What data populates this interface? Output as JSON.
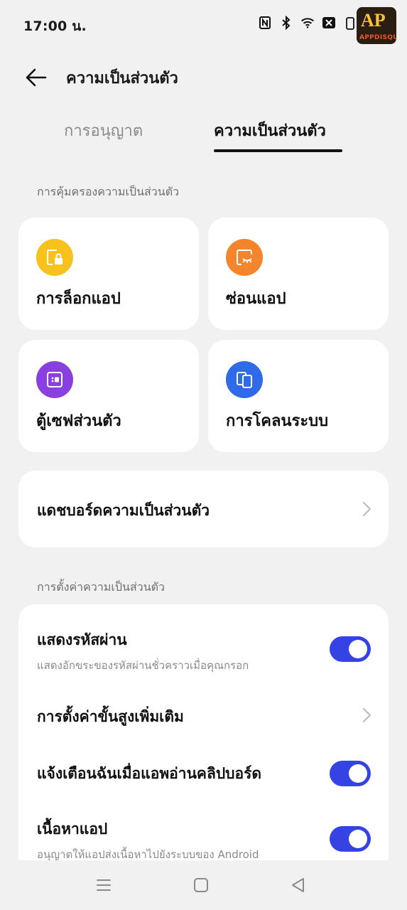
{
  "status_bar": {
    "time": "17:00 น.",
    "icons": [
      "nfc-icon",
      "bluetooth-icon",
      "wifi-icon",
      "sim-off-icon",
      "battery-icon"
    ],
    "logo_text_main": "AP",
    "logo_text_sub": "APPDISQUS"
  },
  "header": {
    "title": "ความเป็นส่วนตัว"
  },
  "tabs": [
    {
      "label": "การอนุญาต",
      "active": false
    },
    {
      "label": "ความเป็นส่วนตัว",
      "active": true
    }
  ],
  "protection": {
    "section_label": "การคุ้มครองความเป็นส่วนตัว",
    "tiles": [
      {
        "label": "การล็อกแอป",
        "icon": "app-lock-icon",
        "color": "#f7c21b"
      },
      {
        "label": "ซ่อนแอป",
        "icon": "hide-app-icon",
        "color": "#f5852c"
      },
      {
        "label": "ตู้เซฟส่วนตัว",
        "icon": "private-safe-icon",
        "color": "#8a3fe0"
      },
      {
        "label": "การโคลนระบบ",
        "icon": "system-clone-icon",
        "color": "#2f6be8"
      }
    ],
    "dashboard_label": "แดชบอร์ดความเป็นส่วนตัว"
  },
  "settings": {
    "section_label": "การตั้งค่าความเป็นส่วนตัว",
    "rows": [
      {
        "title": "แสดงรหัสผ่าน",
        "subtitle": "แสดงอักขระของรหัสผ่านชั่วคราวเมื่อคุณกรอก",
        "control": "toggle",
        "on": true
      },
      {
        "title": "การตั้งค่าขั้นสูงเพิ่มเติม",
        "subtitle": "",
        "control": "chevron"
      },
      {
        "title": "แจ้งเตือนฉันเมื่อแอพอ่านคลิปบอร์ด",
        "subtitle": "",
        "control": "toggle",
        "on": true
      },
      {
        "title": "เนื้อหาแอป",
        "subtitle": "อนุญาตให้แอปส่งเนื้อหาไปยังระบบของ Android",
        "control": "toggle",
        "on": true
      }
    ]
  },
  "colors": {
    "accent": "#3543e5",
    "background": "#f1f1f1",
    "card": "#ffffff"
  },
  "nav_bar": [
    "menu-icon",
    "home-icon",
    "back-icon"
  ]
}
